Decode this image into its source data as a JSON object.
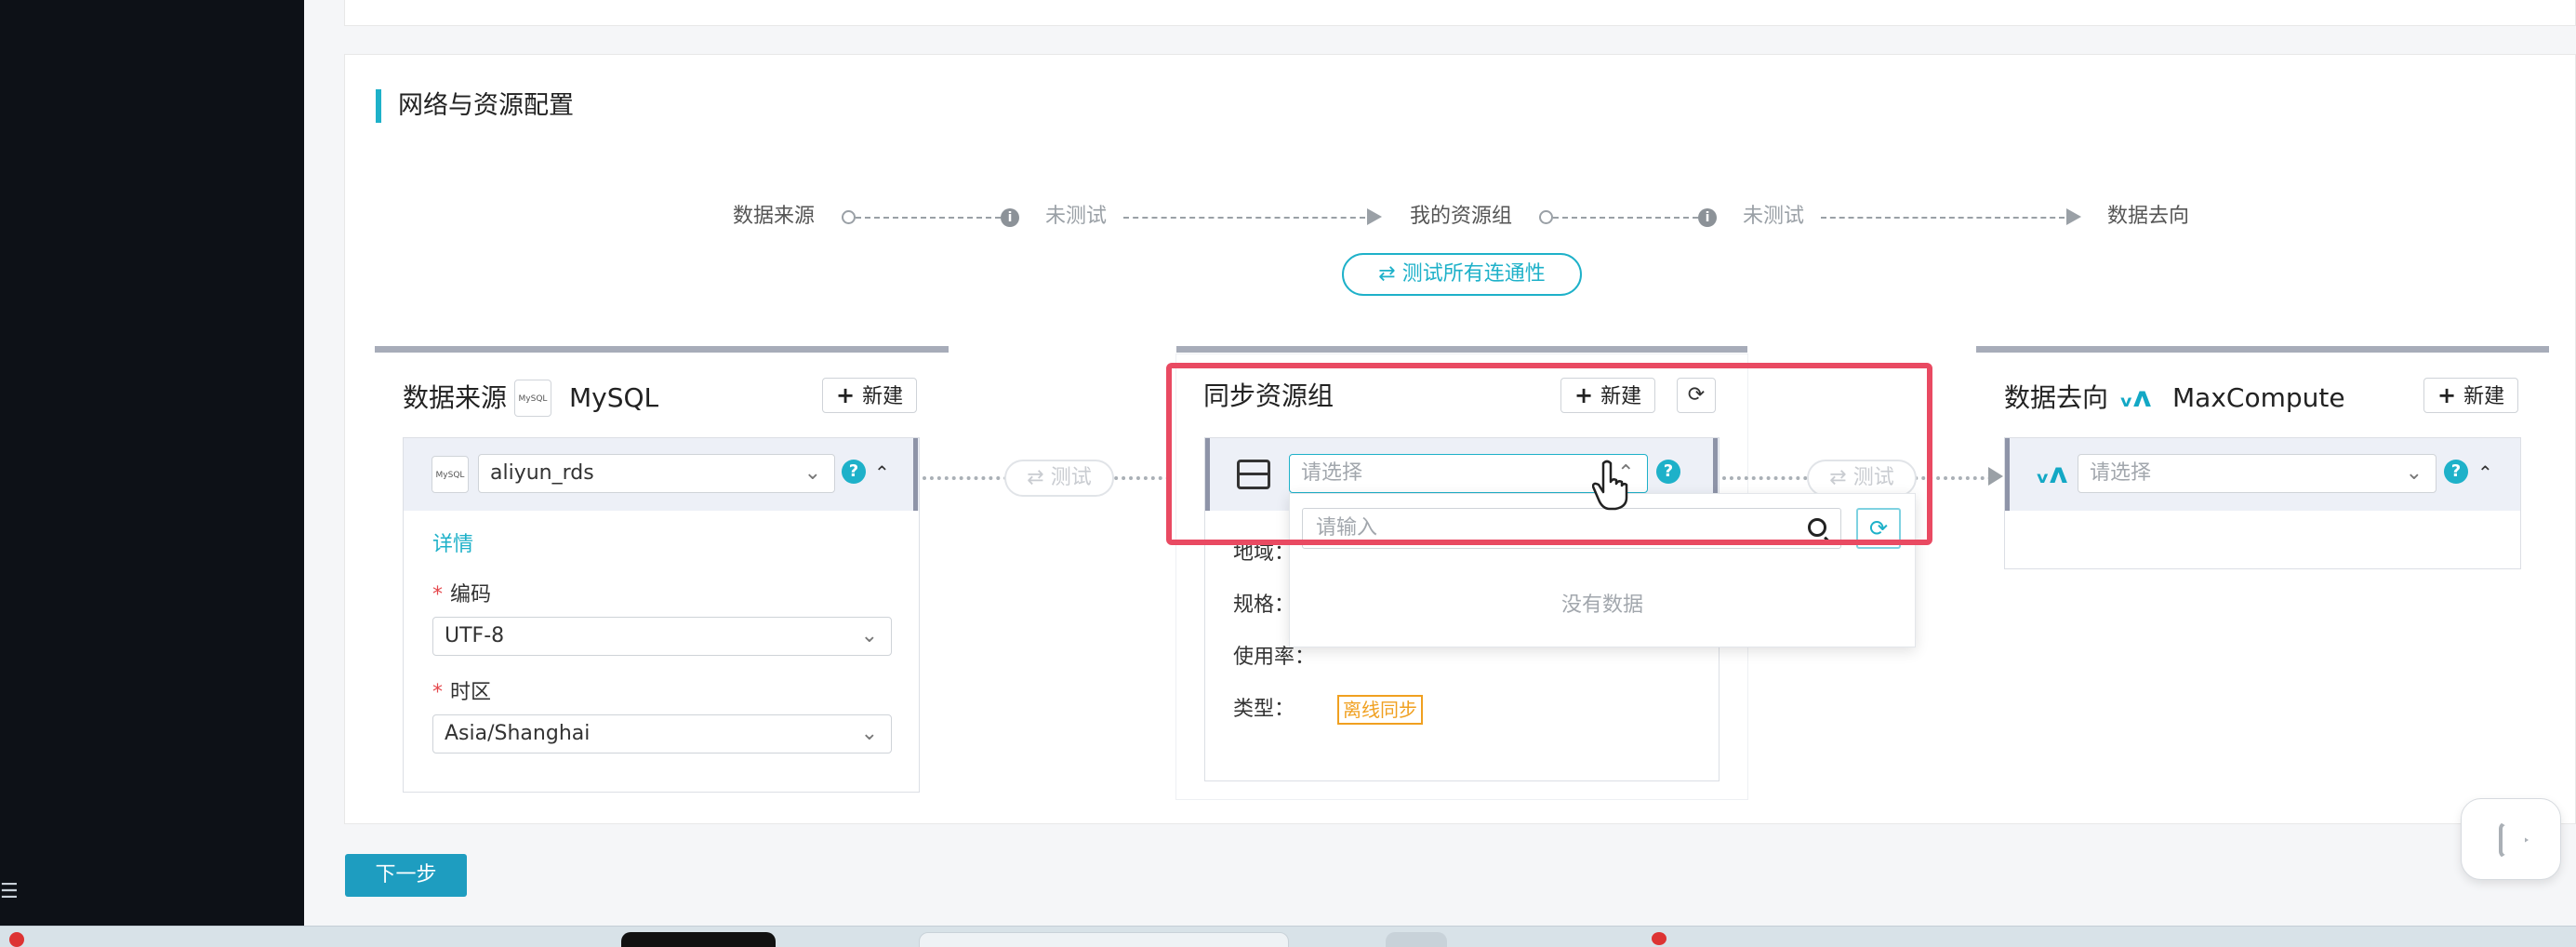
{
  "section": {
    "title": "网络与资源配置"
  },
  "flow": {
    "source": "数据来源",
    "status_1": "未测试",
    "resource_group": "我的资源组",
    "status_2": "未测试",
    "destination": "数据去向",
    "test_all": "测试所有连通性",
    "test_all_icon": "⇄"
  },
  "source_panel": {
    "title": "数据来源",
    "db_name": "MySQL",
    "db_logo_text": "MySQL",
    "new_label": "新建",
    "selected": "aliyun_rds",
    "detail_link": "详情",
    "encoding_label": "编码",
    "encoding_value": "UTF-8",
    "timezone_label": "时区",
    "timezone_value": "Asia/Shanghai"
  },
  "connector": {
    "test_label": "测试",
    "icon": "⇄"
  },
  "resource_panel": {
    "title": "同步资源组",
    "new_label": "新建",
    "placeholder": "请选择",
    "region_label": "地域：",
    "spec_label": "规格：",
    "usage_label": "使用率：",
    "type_label": "类型：",
    "type_tag": "离线同步"
  },
  "dropdown": {
    "search_placeholder": "请输入",
    "empty_text": "没有数据"
  },
  "dest_panel": {
    "title": "数据去向",
    "db_name": "MaxCompute",
    "new_label": "新建",
    "placeholder": "请选择"
  },
  "footer": {
    "next_label": "下一步"
  },
  "colors": {
    "accent": "#1eb1c9",
    "highlight": "#e94a62",
    "tag": "#f0a020"
  }
}
